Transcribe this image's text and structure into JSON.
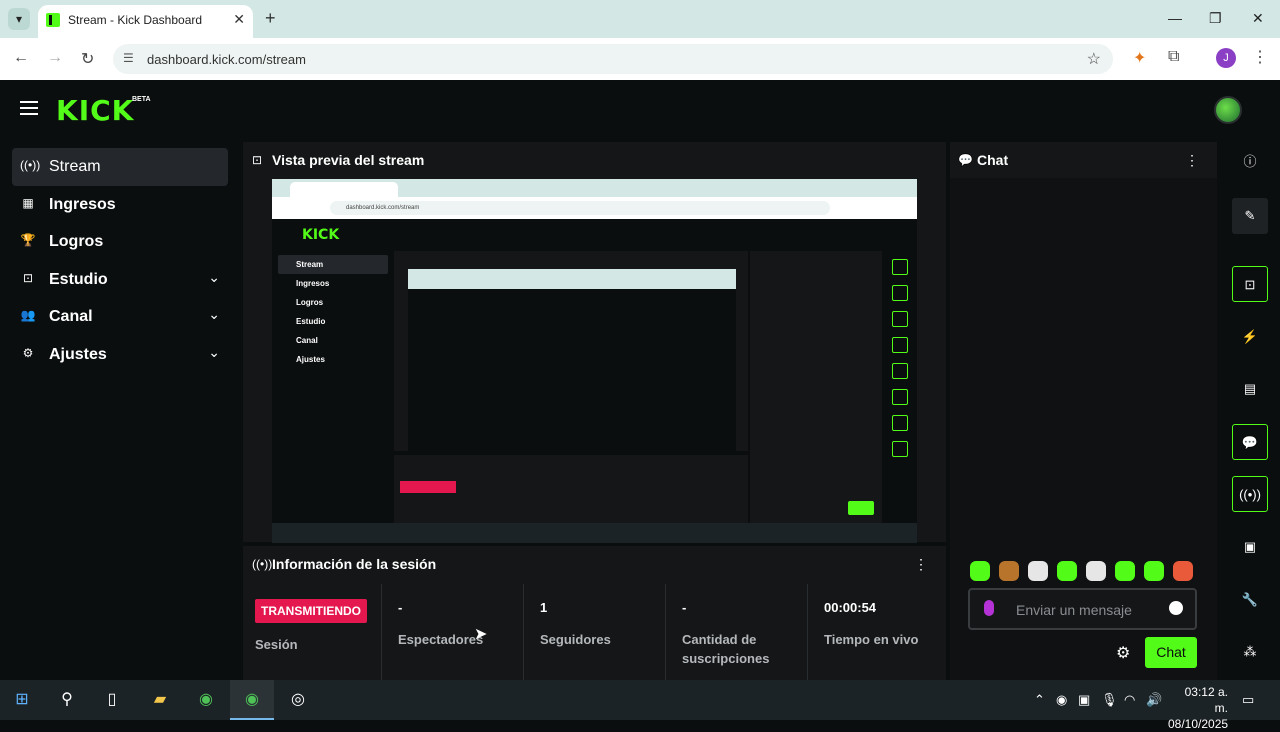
{
  "browser": {
    "tab_title": "Kick Dashboard",
    "tab_title_full": "Stream - Kick Dashboard",
    "url": "dashboard.kick.com/stream",
    "profile_initial": "J"
  },
  "brand": {
    "logo_text": "KICK",
    "badge": "BETA",
    "accent_color": "#53fc18",
    "live_color": "#e4184f"
  },
  "sidebar": {
    "items": [
      {
        "label": "Stream",
        "icon": "broadcast-icon",
        "active": true
      },
      {
        "label": "Ingresos",
        "icon": "chart-icon"
      },
      {
        "label": "Logros",
        "icon": "trophy-icon"
      },
      {
        "label": "Estudio",
        "icon": "studio-icon",
        "expandable": true
      },
      {
        "label": "Canal",
        "icon": "users-icon",
        "expandable": true
      },
      {
        "label": "Ajustes",
        "icon": "gear-icon",
        "expandable": true
      }
    ]
  },
  "preview": {
    "title": "Vista previa del stream"
  },
  "session": {
    "title": "Información de la sesión",
    "badge": "TRANSMITIENDO",
    "session_label": "Sesión",
    "stats": [
      {
        "value": "-",
        "label": "Espectadores"
      },
      {
        "value": "1",
        "label": "Seguidores"
      },
      {
        "value": "-",
        "label": "Cantidad de suscripciones"
      },
      {
        "value": "00:00:54",
        "label": "Tiempo en vivo"
      }
    ]
  },
  "chat": {
    "title": "Chat",
    "placeholder": "Enviar un mensaje",
    "send_label": "Chat"
  },
  "taskbar": {
    "time": "03:12 a. m.",
    "date": "08/10/2025"
  }
}
